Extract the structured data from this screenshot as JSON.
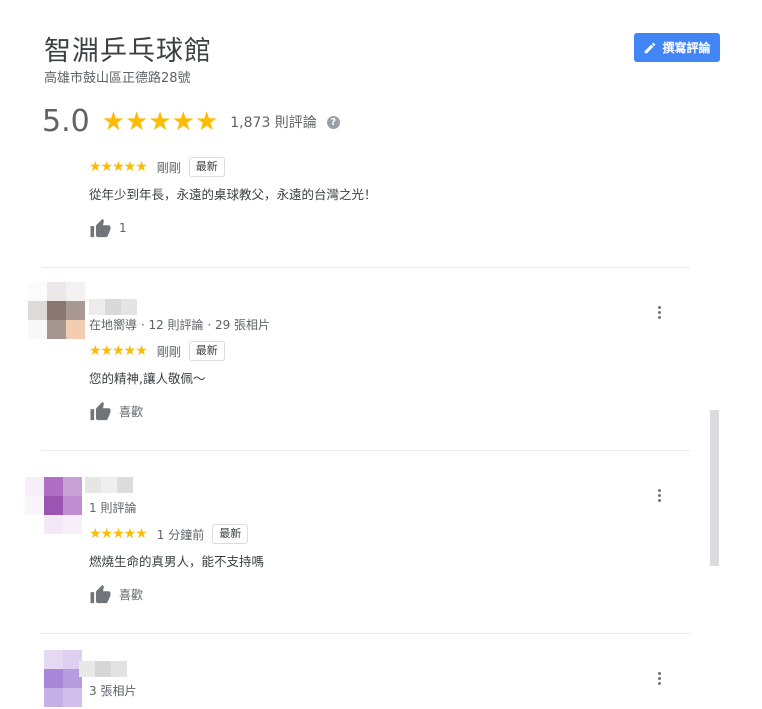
{
  "place": {
    "title": "智淵乒乓球館",
    "address": "高雄市鼓山區正德路28號",
    "rating": "5.0",
    "stars": "★★★★★",
    "review_count": "1,873 則評論",
    "help_glyph": "?"
  },
  "toolbar": {
    "write_review_label": "撰寫評論"
  },
  "reviews": [
    {
      "stars": "★★★★★",
      "time": "剛剛",
      "badge": "最新",
      "text": "從年少到年長，永遠的桌球教父，永遠的台灣之光！",
      "like": "1"
    },
    {
      "meta": "在地嚮導 · 12 則評論 · 29 張相片",
      "stars": "★★★★★",
      "time": "剛剛",
      "badge": "最新",
      "text": "您的精神,讓人敬佩～",
      "like": "喜歡"
    },
    {
      "meta": "1 則評論",
      "stars": "★★★★★",
      "time": "1 分鐘前",
      "badge": "最新",
      "text": "燃燒生命的真男人，能不支持嗎",
      "like": "喜歡"
    },
    {
      "meta": "3 張相片"
    }
  ],
  "colors": {
    "accent": "#4285f4",
    "star": "#fbbc04",
    "muted_text": "#5f6368"
  },
  "icons": {
    "write": "pencil-icon",
    "like": "thumbs-up-icon",
    "more": "more-vert-icon",
    "help": "help-icon"
  }
}
